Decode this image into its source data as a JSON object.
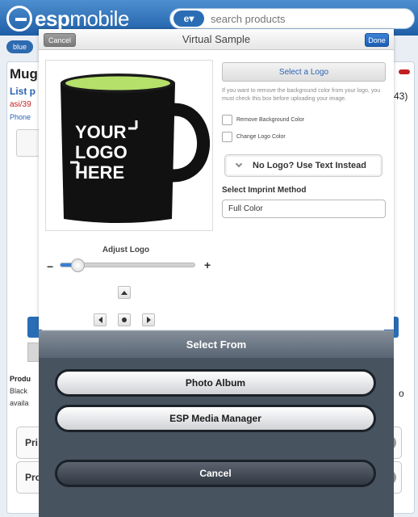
{
  "app": {
    "logo_prefix": "esp",
    "logo_suffix": "mobile",
    "search_placeholder": "search products",
    "breadcrumb": "blue",
    "bg_title": "Mug",
    "bg_list": "List p",
    "bg_asi": "asi/39",
    "bg_phone": "Phone",
    "bg_43": "43)",
    "bg_prod": "Produ",
    "bg_black": "Black",
    "bg_avail": "availa",
    "bg_row1": "Pri",
    "bg_row2": "Pro",
    "bg_o": "o"
  },
  "dialog": {
    "cancel_label": "Cancel",
    "title": "Virtual Sample",
    "done_label": "Done",
    "preview": {
      "logo_lines": [
        "YOUR",
        "LOGO",
        "HERE"
      ],
      "mug_body_color": "#111111",
      "mug_inner_color": "#b5e06a"
    },
    "adjust_label": "Adjust Logo",
    "adjust_level": 0.13,
    "select_logo_label": "Select a Logo",
    "hint_text": "If you want to remove the background color from your logo, you must check this box before uploading your image.",
    "remove_bg_label": "Remove Background Color",
    "change_color_label": "Change Logo Color",
    "no_logo_label": "No Logo? Use Text Instead",
    "imprint_label": "Select Imprint Method",
    "imprint_value": "Full Color"
  },
  "sheet": {
    "title": "Select From",
    "photo_album_label": "Photo Album",
    "media_manager_label": "ESP Media Manager",
    "cancel_label": "Cancel"
  },
  "colors": {
    "brand_blue": "#1f5ea6",
    "accent_link": "#2a62b0",
    "sheet_bg": "#485360"
  }
}
